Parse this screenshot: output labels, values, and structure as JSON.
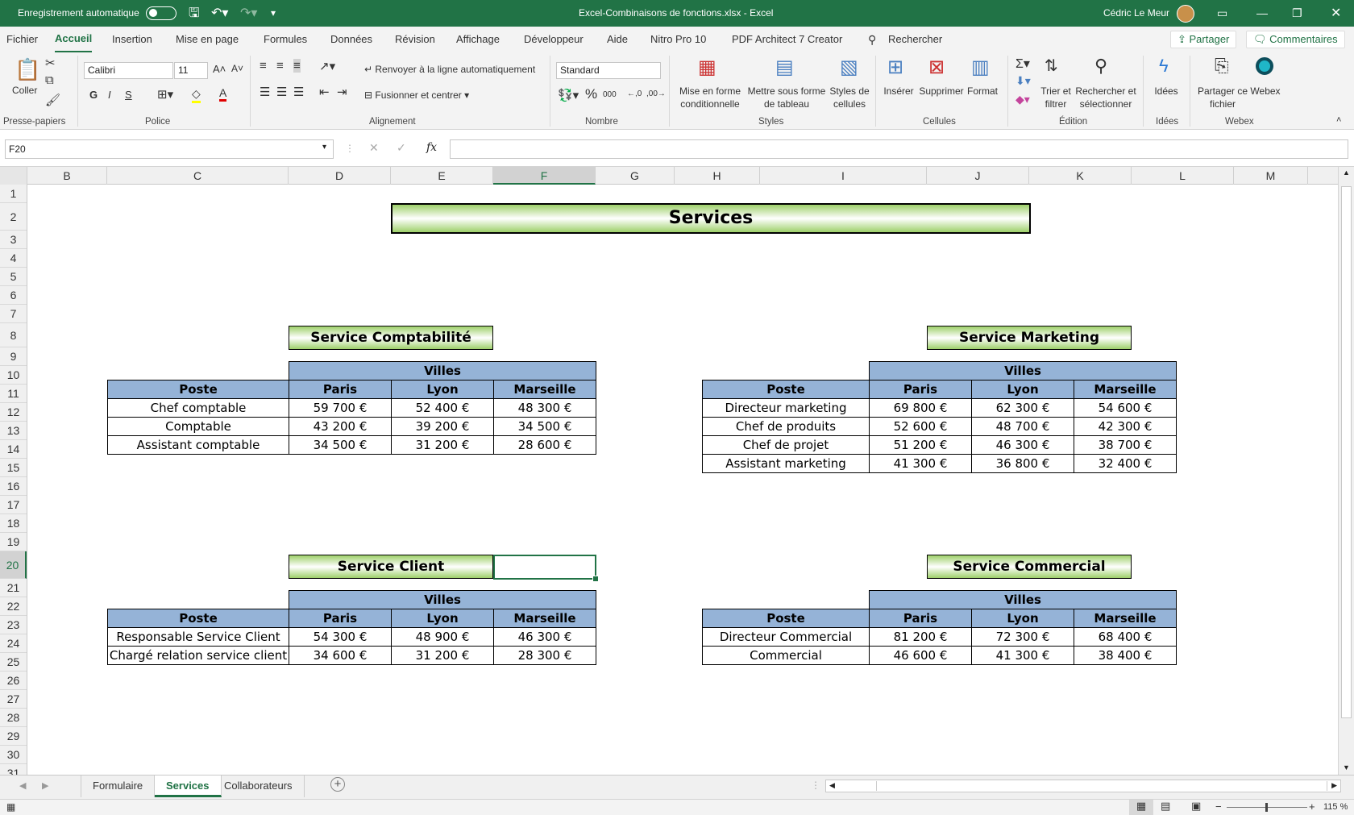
{
  "titlebar": {
    "autosave": "Enregistrement automatique",
    "filename": "Excel-Combinaisons de fonctions.xlsx  -  Excel",
    "user": "Cédric Le Meur"
  },
  "menu": {
    "items": [
      "Fichier",
      "Accueil",
      "Insertion",
      "Mise en page",
      "Formules",
      "Données",
      "Révision",
      "Affichage",
      "Développeur",
      "Aide",
      "Nitro Pro 10",
      "PDF Architect 7 Creator"
    ],
    "search": "Rechercher",
    "share": "Partager",
    "comments": "Commentaires"
  },
  "ribbon": {
    "paste": "Coller",
    "font_name": "Calibri",
    "font_size": "11",
    "bold": "G",
    "italic": "I",
    "underline": "S",
    "wrap_text": "Renvoyer à la ligne automatiquement",
    "merge_center": "Fusionner et centrer",
    "number_format": "Standard",
    "conditional_format": "Mise en forme conditionnelle",
    "format_as_table": "Mettre sous forme de tableau",
    "cell_styles": "Styles de cellules",
    "insert": "Insérer",
    "delete": "Supprimer",
    "format": "Format",
    "sort_filter": "Trier et filtrer",
    "find_select": "Rechercher et sélectionner",
    "ideas": "Idées",
    "share_file": "Partager ce fichier",
    "webex": "Webex",
    "groups": {
      "clipboard": "Presse-papiers",
      "font": "Police",
      "alignment": "Alignement",
      "number": "Nombre",
      "styles": "Styles",
      "cells": "Cellules",
      "editing": "Édition",
      "ideas": "Idées",
      "webex": "Webex"
    }
  },
  "formula_bar": {
    "name_box": "F20",
    "formula": ""
  },
  "columns": [
    "B",
    "C",
    "D",
    "E",
    "F",
    "G",
    "H",
    "I",
    "J",
    "K",
    "L",
    "M"
  ],
  "selected_column": "F",
  "selected_row": "20",
  "rows": [
    "1",
    "2",
    "3",
    "4",
    "5",
    "6",
    "7",
    "8",
    "9",
    "10",
    "11",
    "12",
    "13",
    "14",
    "15",
    "16",
    "17",
    "18",
    "19",
    "20",
    "21",
    "22",
    "23",
    "24",
    "25",
    "26",
    "27",
    "28",
    "29",
    "30",
    "31"
  ],
  "sheet": {
    "title": "Services",
    "villes_label": "Villes",
    "poste_label": "Poste",
    "cities": [
      "Paris",
      "Lyon",
      "Marseille"
    ],
    "comptabilite": {
      "title": "Service Comptabilité",
      "rows": [
        {
          "poste": "Chef comptable",
          "paris": "59 700 €",
          "lyon": "52 400 €",
          "marseille": "48 300 €"
        },
        {
          "poste": "Comptable",
          "paris": "43 200 €",
          "lyon": "39 200 €",
          "marseille": "34 500 €"
        },
        {
          "poste": "Assistant comptable",
          "paris": "34 500 €",
          "lyon": "31 200 €",
          "marseille": "28 600 €"
        }
      ]
    },
    "marketing": {
      "title": "Service Marketing",
      "rows": [
        {
          "poste": "Directeur marketing",
          "paris": "69 800 €",
          "lyon": "62 300 €",
          "marseille": "54 600 €"
        },
        {
          "poste": "Chef de produits",
          "paris": "52 600 €",
          "lyon": "48 700 €",
          "marseille": "42 300 €"
        },
        {
          "poste": "Chef de projet",
          "paris": "51 200 €",
          "lyon": "46 300 €",
          "marseille": "38 700 €"
        },
        {
          "poste": "Assistant marketing",
          "paris": "41 300 €",
          "lyon": "36 800 €",
          "marseille": "32 400 €"
        }
      ]
    },
    "client": {
      "title": "Service Client",
      "rows": [
        {
          "poste": "Responsable Service Client",
          "paris": "54 300 €",
          "lyon": "48 900 €",
          "marseille": "46 300 €"
        },
        {
          "poste": "Chargé relation service client",
          "paris": "34 600 €",
          "lyon": "31 200 €",
          "marseille": "28 300 €"
        }
      ]
    },
    "commercial": {
      "title": "Service Commercial",
      "rows": [
        {
          "poste": "Directeur Commercial",
          "paris": "81 200 €",
          "lyon": "72 300 €",
          "marseille": "68 400 €"
        },
        {
          "poste": "Commercial",
          "paris": "46 600 €",
          "lyon": "41 300 €",
          "marseille": "38 400 €"
        }
      ]
    }
  },
  "sheet_tabs": [
    "Formulaire",
    "Services",
    "Collaborateurs"
  ],
  "active_tab": "Services",
  "zoom": "115 %",
  "colors": {
    "accent": "#217346",
    "header_blue": "#95b3d7",
    "banner_green": "#9ed06a"
  }
}
